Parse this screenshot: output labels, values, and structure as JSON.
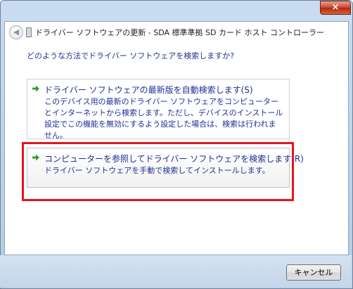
{
  "window": {
    "title": "ドライバー ソフトウェアの更新 - SDA 標準準拠 SD カード ホスト コントローラー",
    "close_label": "×"
  },
  "question": "どのような方法でドライバー ソフトウェアを検索しますか?",
  "options": [
    {
      "title": "ドライバー ソフトウェアの最新版を自動検索します(S)",
      "description": "このデバイス用の最新のドライバー ソフトウェアをコンピューターとインターネットから検索します。ただし、デバイスのインストール設定でこの機能を無効にするよう設定した場合は、検索は行われません。"
    },
    {
      "title": "コンピューターを参照してドライバー ソフトウェアを検索します(R)",
      "description": "ドライバー ソフトウェアを手動で検索してインストールします。"
    }
  ],
  "buttons": {
    "cancel": "キャンセル"
  },
  "icons": {
    "back": "back-arrow-icon",
    "device": "device-icon",
    "option_arrow": "green-arrow-icon"
  },
  "colors": {
    "highlight_border": "#e8131b",
    "link_text": "#1e2f94",
    "arrow_green": "#2f9e2f"
  }
}
